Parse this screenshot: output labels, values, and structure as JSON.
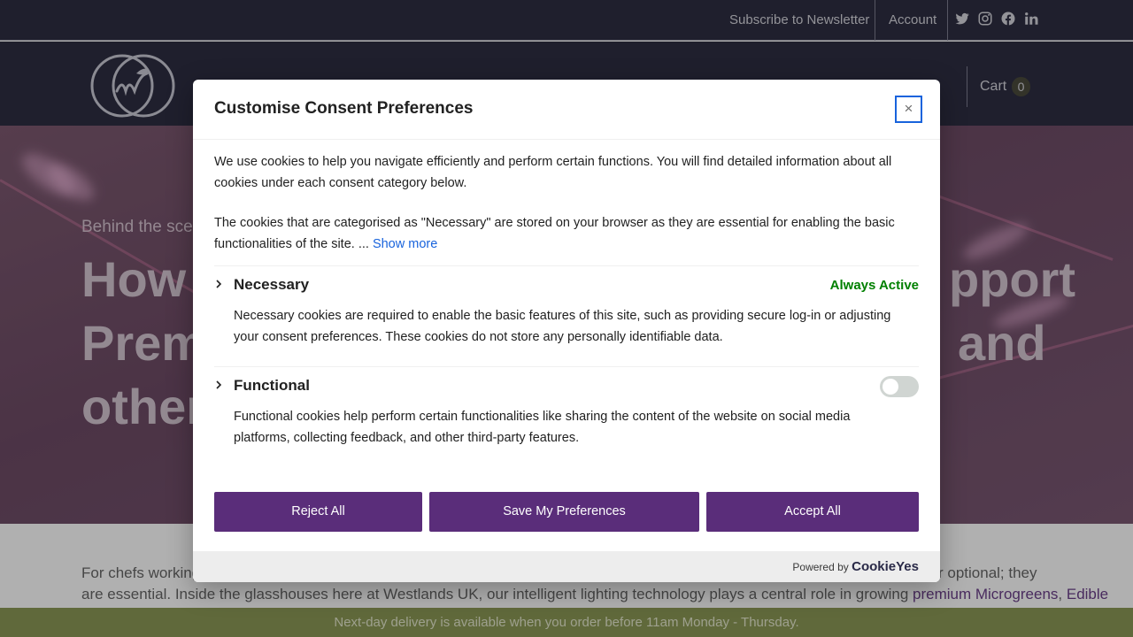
{
  "topbar": {
    "newsletter": "Subscribe to Newsletter",
    "account": "Account",
    "social": [
      "twitter-icon",
      "instagram-icon",
      "facebook-icon",
      "linkedin-icon"
    ]
  },
  "header": {
    "cart_label": "Cart",
    "cart_count": "0"
  },
  "hero": {
    "kicker": "Behind the scen",
    "title_lines": {
      "l1_left": "How",
      "l1_right": "pport",
      "l2_left": "Prem",
      "l2_right": "and",
      "l3_left": "other"
    }
  },
  "body": {
    "line1_left": "For chefs working",
    "line1_right": "r optional; they",
    "line2_text": "are essential. Inside the glasshouses here at Westlands UK, our intelligent lighting technology plays a central role in growing ",
    "line2_link1": "premium Microgreens",
    "line2_comma": ", ",
    "line2_link2": "Edible"
  },
  "bottombar": {
    "text": "Next-day delivery is available when you order before 11am Monday - Thursday."
  },
  "modal": {
    "title": "Customise Consent Preferences",
    "close": "×",
    "intro": "We use cookies to help you navigate efficiently and perform certain functions. You will find detailed information about all cookies under each consent category below.",
    "necessary_info": "The cookies that are categorised as \"Necessary\" are stored on your browser as they are essential for enabling the basic functionalities of the site. ... ",
    "show_more": "Show more",
    "categories": [
      {
        "title": "Necessary",
        "status": "Always Active",
        "desc": "Necessary cookies are required to enable the basic features of this site, such as providing secure log-in or adjusting your consent preferences. These cookies do not store any personally identifiable data."
      },
      {
        "title": "Functional",
        "enabled": false,
        "desc": "Functional cookies help perform certain functionalities like sharing the content of the website on social media platforms, collecting feedback, and other third-party features."
      }
    ],
    "buttons": {
      "reject": "Reject All",
      "save": "Save My Preferences",
      "accept": "Accept All"
    },
    "footer": {
      "powered_by": "Powered by",
      "brand": "CookieYes"
    }
  },
  "colors": {
    "nav_bg": "#1b1b30",
    "accent_purple": "#5a2d7a",
    "active_green": "#008000",
    "close_border": "#1863dc",
    "delivery_bar": "#7d8a45"
  }
}
